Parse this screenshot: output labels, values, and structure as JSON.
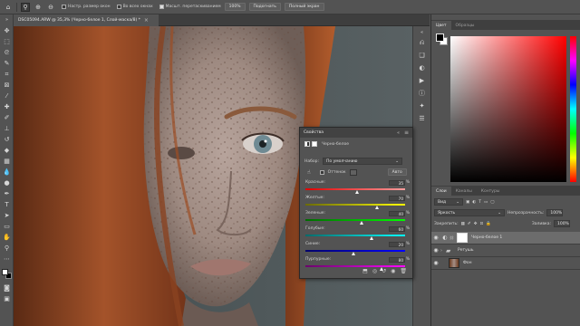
{
  "options_bar": {
    "zoom_in_icon": "zoom-in-icon",
    "zoom_out_icon": "zoom-out-icon",
    "resize_windows": "Настр. размер окон",
    "all_windows": "Во всех окнах",
    "scrubby_zoom": "Масшт. перетаскиванием",
    "zoom_value": "100%",
    "fit_button": "Подогнать",
    "fill_screen_button": "Полный экран"
  },
  "document": {
    "tab_title": "DSC05094.ARW @ 35,3% (Черно-белое 1, Слой-маска/8) *",
    "close_glyph": "×"
  },
  "color_panel": {
    "tabs": [
      "Цвет",
      "Образцы"
    ],
    "active_tab": 0
  },
  "layers_panel": {
    "tabs": [
      "Слои",
      "Каналы",
      "Контуры"
    ],
    "active_tab": 0,
    "filter_label": "Вид",
    "blend_mode": "Яркость",
    "opacity_label": "Непрозрачность:",
    "opacity_value": "100%",
    "lock_label": "Закрепить:",
    "fill_label": "Заливка:",
    "fill_value": "100%",
    "layers": [
      {
        "name": "Черно-белое 1",
        "selected": true
      },
      {
        "name": "Ретушь",
        "selected": false
      },
      {
        "name": "Фон",
        "selected": false
      }
    ]
  },
  "properties_panel": {
    "title": "Свойства",
    "subtitle": "Черно-белое",
    "preset_label": "Набор:",
    "preset_value": "По умолчанию",
    "tint_label": "Оттенок",
    "auto_button": "Авто",
    "sliders": [
      {
        "label": "Красные:",
        "value": "35",
        "fraction": 0.52,
        "from": "#e00000",
        "to": "#ff9d9d"
      },
      {
        "label": "Желтые:",
        "value": "70",
        "fraction": 0.72,
        "from": "#6b6b00",
        "to": "#ffff00"
      },
      {
        "label": "Зеленые:",
        "value": "40",
        "fraction": 0.56,
        "from": "#006b00",
        "to": "#00ff00"
      },
      {
        "label": "Голубые:",
        "value": "60",
        "fraction": 0.66,
        "from": "#006b6b",
        "to": "#00ffff"
      },
      {
        "label": "Синие:",
        "value": "20",
        "fraction": 0.48,
        "from": "#00006b",
        "to": "#0000ff"
      },
      {
        "label": "Пурпурные:",
        "value": "80",
        "fraction": 0.76,
        "from": "#6b006b",
        "to": "#ff00ff"
      }
    ]
  }
}
